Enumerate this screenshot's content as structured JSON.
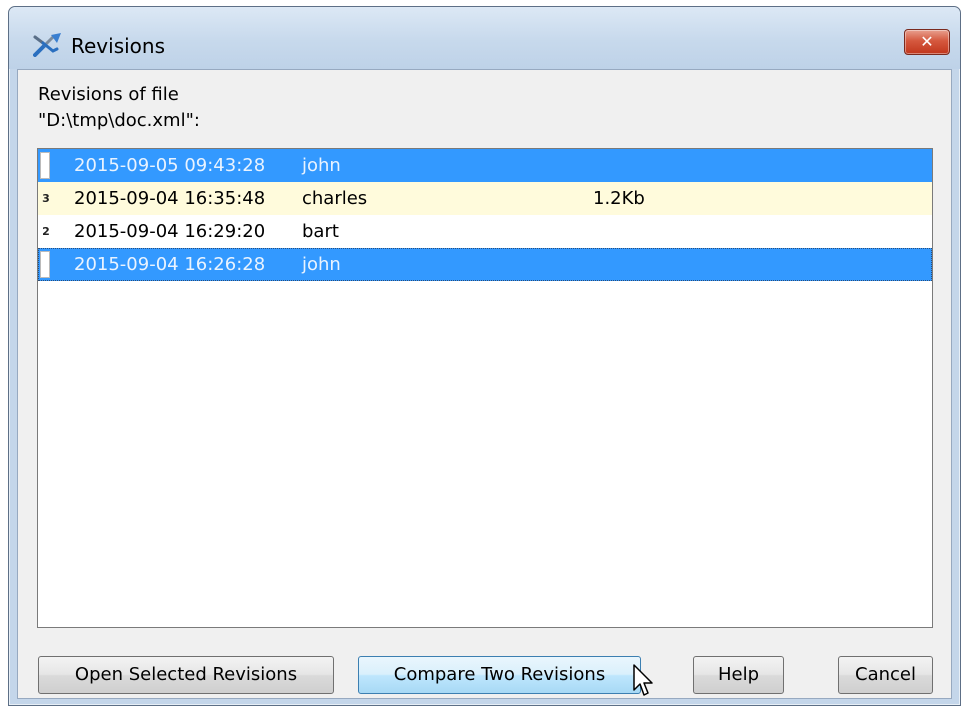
{
  "window": {
    "title": "Revisions",
    "close_glyph": "✕"
  },
  "header": {
    "line1": "Revisions of file",
    "line2": "\"D:\\tmp\\doc.xml\":"
  },
  "revisions": [
    {
      "marker": "",
      "date": "2015-09-05 09:43:28",
      "author": "john",
      "size": "",
      "state": "selected"
    },
    {
      "marker": "3",
      "date": "2015-09-04 16:35:48",
      "author": "charles",
      "size": "1.2Kb",
      "state": "highlighted"
    },
    {
      "marker": "2",
      "date": "2015-09-04 16:29:20",
      "author": "bart",
      "size": "",
      "state": "normal"
    },
    {
      "marker": "",
      "date": "2015-09-04 16:26:28",
      "author": "john",
      "size": "",
      "state": "selected-focused"
    }
  ],
  "buttons": {
    "open": "Open Selected Revisions",
    "compare": "Compare Two Revisions",
    "help": "Help",
    "cancel": "Cancel"
  },
  "colors": {
    "selection": "#3399ff",
    "highlight_row": "#fffbdc",
    "client_bg": "#f0f0f0",
    "close_button": "#d5583e"
  },
  "icons": {
    "app": "compare-arrows-icon",
    "close": "close-icon",
    "cursor": "mouse-pointer-icon"
  }
}
